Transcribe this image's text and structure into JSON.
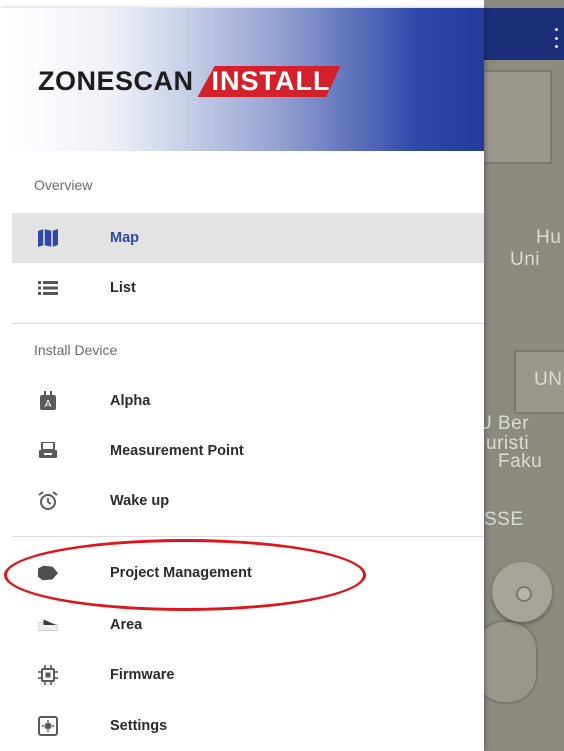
{
  "header": {
    "logo_main": "ZONESCAN",
    "logo_sub": "INSTALL"
  },
  "sections": {
    "overview": "Overview",
    "install_device": "Install Device"
  },
  "menu": {
    "map": "Map",
    "list": "List",
    "alpha": "Alpha",
    "measurement_point": "Measurement Point",
    "wake_up": "Wake up",
    "project_management": "Project Management",
    "area": "Area",
    "firmware": "Firmware",
    "settings": "Settings"
  },
  "map_labels": {
    "l1": "Hu",
    "l2": "Uni",
    "l3": "UN",
    "l4": "U Ber",
    "l5": "uristi",
    "l6": "Faku",
    "l7": "SSE"
  },
  "colors": {
    "accent": "#2f49a3",
    "brand_red": "#d3202a",
    "highlight_ring": "#e0141b",
    "active_bg": "#e3e3e3"
  },
  "icons": {
    "map": "map-icon",
    "list": "list-icon",
    "alpha": "alpha-device-icon",
    "measurement_point": "measurement-point-icon",
    "wake_up": "alarm-clock-icon",
    "project_management": "project-folder-icon",
    "area": "area-icon",
    "firmware": "chip-icon",
    "settings": "settings-icon",
    "overflow": "more-vert-icon",
    "location": "my-location-icon"
  }
}
